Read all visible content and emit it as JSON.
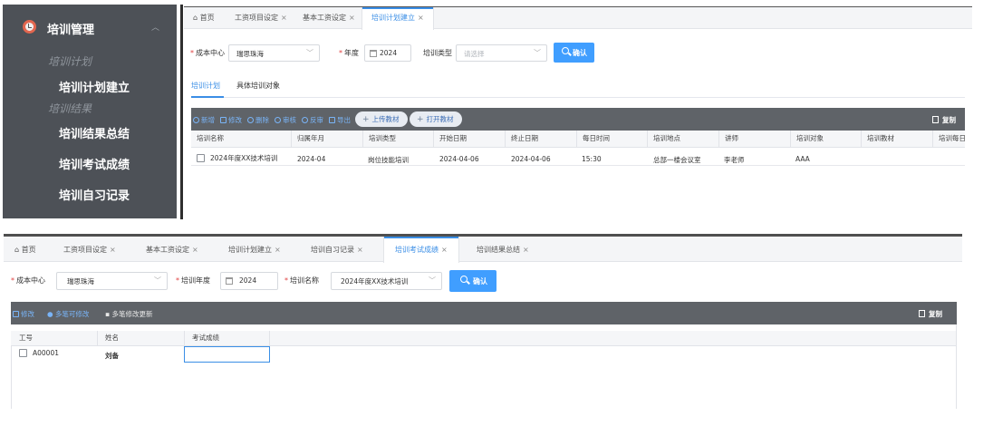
{
  "sidebar": {
    "title": "培训管理",
    "groups": [
      "培训计划",
      "培训结果"
    ],
    "items": [
      "培训计划建立",
      "培训结果总结",
      "培训考试成绩",
      "培训自习记录"
    ]
  },
  "panel1": {
    "tabs": [
      {
        "label": "首页",
        "close": ""
      },
      {
        "label": "工资项目设定",
        "close": "×"
      },
      {
        "label": "基本工资设定",
        "close": "×"
      },
      {
        "label": "培训计划建立",
        "close": "×"
      }
    ],
    "filters": {
      "cost_center_label": "成本中心",
      "cost_center_value": "瑞思珠海",
      "year_label": "年度",
      "year_value": "2024",
      "type_label": "培训类型",
      "type_placeholder": "请选择",
      "confirm": "确认"
    },
    "subtabs": [
      "培训计划",
      "具体培训对象"
    ],
    "toolbar": {
      "add": "新增",
      "edit": "修改",
      "delete": "删除",
      "approve": "审核",
      "unapprove": "反审",
      "export": "导出",
      "upload": "上传教材",
      "open": "打开教材",
      "copy": "复制"
    },
    "columns": [
      "培训名称",
      "归属年月",
      "培训类型",
      "开始日期",
      "终止日期",
      "每日时间",
      "培训地点",
      "讲师",
      "培训对象",
      "培训教材",
      "培训每日"
    ],
    "rows": [
      [
        "2024年度XX技术培训",
        "2024-04",
        "岗位技能培训",
        "2024-04-06",
        "2024-04-06",
        "15:30",
        "总部一楼会议室",
        "李老师",
        "AAA",
        "",
        ""
      ]
    ]
  },
  "panel2": {
    "tabs": [
      {
        "label": "首页",
        "close": ""
      },
      {
        "label": "工资项目设定",
        "close": "×"
      },
      {
        "label": "基本工资设定",
        "close": "×"
      },
      {
        "label": "培训计划建立",
        "close": "×"
      },
      {
        "label": "培训自习记录",
        "close": "×"
      },
      {
        "label": "培训考试成绩",
        "close": "×"
      },
      {
        "label": "培训结果总结",
        "close": "×"
      }
    ],
    "filters": {
      "cost_center_label": "成本中心",
      "cost_center_value": "瑞思珠海",
      "year_label": "培训年度",
      "year_value": "2024",
      "name_label": "培训名称",
      "name_value": "2024年度XX技术培训",
      "confirm": "确认"
    },
    "toolbar": {
      "edit": "修改",
      "multi_edit": "多笔可修改",
      "multi_update": "多笔修改更新",
      "copy": "复制"
    },
    "columns": [
      "工号",
      "姓名",
      "考试成绩"
    ],
    "rows": [
      [
        "A00001",
        "刘备",
        ""
      ]
    ]
  },
  "colors": {
    "sidebar_bg": "#4d5157",
    "accent": "#409eff",
    "toolbar_bg": "#5f6368",
    "required": "#e04040"
  }
}
